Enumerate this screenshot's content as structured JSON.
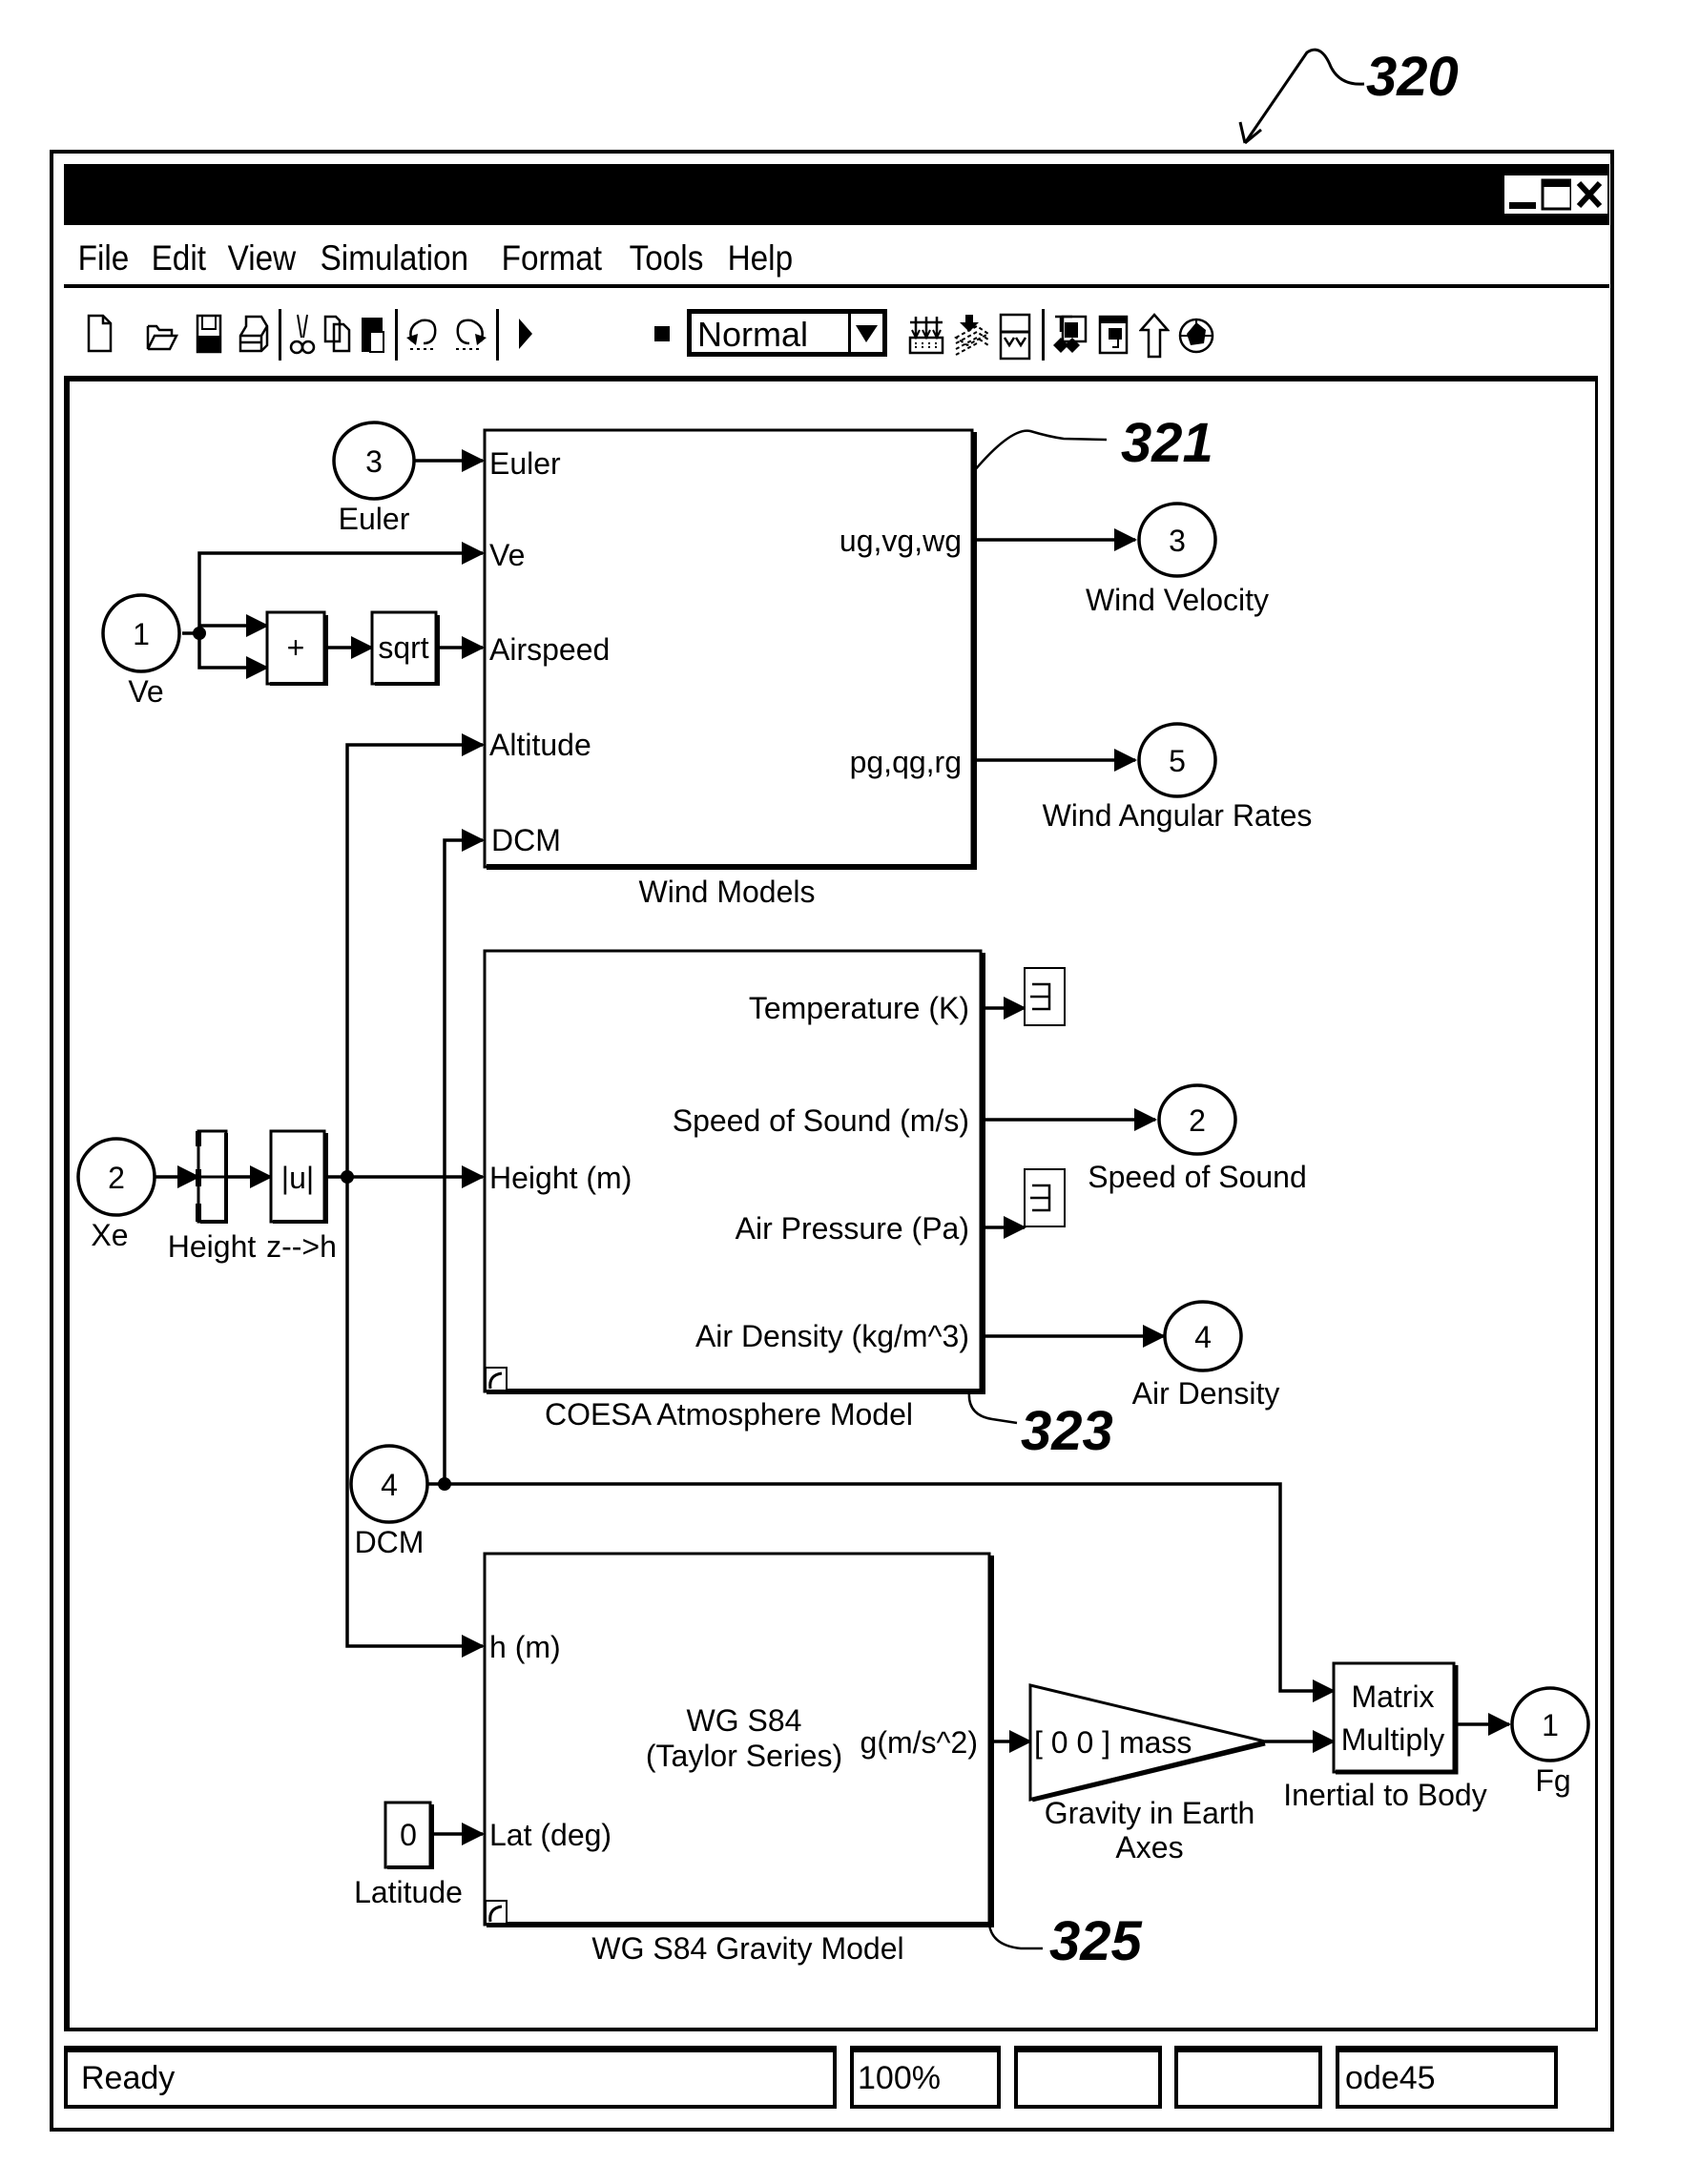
{
  "figure_reference": "320",
  "window": {
    "title": "",
    "controls": {
      "minimize_icon": "minimize-icon",
      "maximize_icon": "maximize-icon",
      "close_icon": "close-icon"
    }
  },
  "menu": {
    "items": [
      "File",
      "Edit",
      "View",
      "Simulation",
      "Format",
      "Tools",
      "Help"
    ]
  },
  "toolbar": {
    "icons": [
      "new-file-icon",
      "open-folder-icon",
      "save-icon",
      "print-icon",
      "cut-icon",
      "copy-icon",
      "paste-icon",
      "undo-icon",
      "redo-icon",
      "start-simulation-icon",
      "stop-simulation-icon",
      "build-icon",
      "update-diagram-icon",
      "build-subsystem-icon",
      "library-browser-icon",
      "model-explorer-icon",
      "go-to-parent-icon",
      "debug-icon"
    ],
    "simulation_mode": "Normal"
  },
  "diagram": {
    "reference_labels": {
      "wind": "321",
      "atmosphere": "323",
      "gravity": "325"
    },
    "wind_models": {
      "name": "Wind Models",
      "inputs": [
        "Euler",
        "Ve",
        "Airspeed",
        "Altitude",
        "DCM"
      ],
      "outputs": [
        "ug,vg,wg",
        "pg,qg,rg"
      ]
    },
    "atmosphere": {
      "name": "COESA Atmosphere Model",
      "inputs": [
        "Height (m)"
      ],
      "outputs": [
        "Temperature (K)",
        "Speed of Sound (m/s)",
        "Air Pressure (Pa)",
        "Air Density (kg/m^3)"
      ]
    },
    "gravity": {
      "name": "WG S84 Gravity Model",
      "body_line1": "WG S84",
      "body_line2": "(Taylor Series)",
      "inputs": [
        "h (m)",
        "Lat (deg)"
      ],
      "outputs": [
        "g(m/s^2)"
      ]
    },
    "inports": [
      {
        "number": "3",
        "label": "Euler"
      },
      {
        "number": "1",
        "label": "Ve"
      },
      {
        "number": "2",
        "label": "Xe"
      },
      {
        "number": "4",
        "label": "DCM"
      }
    ],
    "outports": [
      {
        "number": "3",
        "label": "Wind Velocity"
      },
      {
        "number": "5",
        "label": "Wind Angular Rates"
      },
      {
        "number": "2",
        "label": "Speed of Sound"
      },
      {
        "number": "4",
        "label": "Air Density"
      },
      {
        "number": "1",
        "label": "Fg"
      }
    ],
    "blocks": {
      "sum": "+",
      "sqrt": "sqrt",
      "selector_label": "Height",
      "abs": "|u|",
      "abs_label": "z-->h",
      "latitude_value": "0",
      "latitude_label": "Latitude",
      "gain_value": "[ 0 0 ] mass",
      "gain_label_line1": "Gravity in Earth",
      "gain_label_line2": "Axes",
      "matmul_line1": "Matrix",
      "matmul_line2": "Multiply",
      "matmul_label": "Inertial to Body"
    }
  },
  "status": {
    "message": "Ready",
    "zoom": "100%",
    "field3": "",
    "field4": "",
    "solver": "ode45"
  }
}
